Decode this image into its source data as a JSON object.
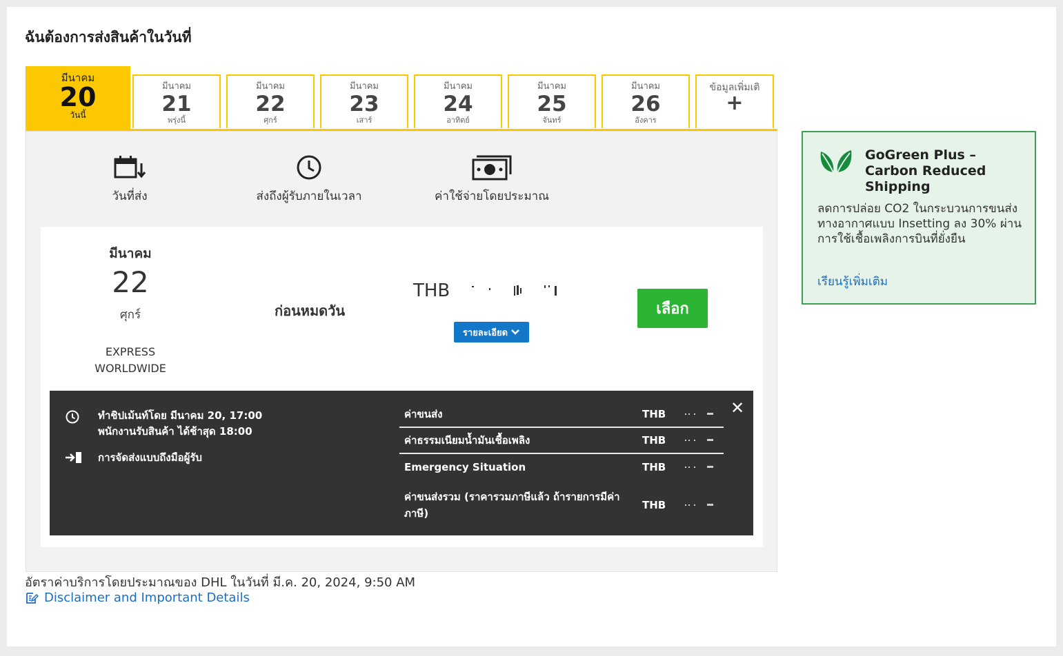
{
  "heading": "ฉันต้องการส่งสินค้าในวันที่",
  "tabs": [
    {
      "month": "มีนาคม",
      "day": "20",
      "weekday": "วันนี้",
      "active": true
    },
    {
      "month": "มีนาคม",
      "day": "21",
      "weekday": "พรุ่งนี้"
    },
    {
      "month": "มีนาคม",
      "day": "22",
      "weekday": "ศุกร์"
    },
    {
      "month": "มีนาคม",
      "day": "23",
      "weekday": "เสาร์"
    },
    {
      "month": "มีนาคม",
      "day": "24",
      "weekday": "อาทิตย์"
    },
    {
      "month": "มีนาคม",
      "day": "25",
      "weekday": "จันทร์"
    },
    {
      "month": "มีนาคม",
      "day": "26",
      "weekday": "อังคาร"
    }
  ],
  "more_tab": {
    "label": "ข้อมูลเพิ่มเติ",
    "icon": "+"
  },
  "columns": {
    "ship_date": "วันที่ส่ง",
    "delivered_by": "ส่งถึงผู้รับภายในเวลา",
    "estimated_cost": "ค่าใช้จ่ายโดยประมาณ"
  },
  "option": {
    "month": "มีนาคม",
    "day": "22",
    "weekday": "ศุกร์",
    "product": "EXPRESS WORLDWIDE",
    "delivery_time": "ก่อนหมดวัน",
    "currency": "THB",
    "details_label": "รายละเอียด",
    "select_label": "เลือก"
  },
  "details": {
    "pickup_line1": "ทำชิปเม้นท์โดย มีนาคม 20, 17:00",
    "pickup_line2": "พนักงานรับสินค้า ได้ช้าสุด 18:00",
    "delivery_type": "การจัดส่งแบบถึงมือผู้รับ",
    "charges": [
      {
        "label": "ค่าขนส่ง",
        "currency": "THB"
      },
      {
        "label": "ค่าธรรมเนียมน้ำมันเชื้อเพลิง",
        "currency": "THB"
      },
      {
        "label": "Emergency Situation",
        "currency": "THB"
      },
      {
        "label": "ค่าขนส่งรวม (ราคารวมภาษีแล้ว ถ้ารายการมีค่าภาษี)",
        "currency": "THB"
      }
    ]
  },
  "footer": {
    "rate_note": "อัตราค่าบริการโดยประมาณของ DHL ในวันที่ มี.ค. 20, 2024, 9:50 AM",
    "disclaimer_link": "Disclaimer and Important Details"
  },
  "gogreen": {
    "title_line1": "GoGreen Plus –",
    "title_line2": "Carbon Reduced",
    "title_line3": "Shipping",
    "text": "ลดการปล่อย CO2 ในกระบวนการขนส่งทางอากาศแบบ Insetting ลง 30% ผ่านการใช้เชื้อเพลิงการบินที่ยั่งยืน",
    "link": "เรียนรู้เพิ่มเติม"
  },
  "colors": {
    "accent": "#fcc900",
    "select": "#2bb533",
    "details": "#1276c9",
    "dark": "#333333",
    "link": "#1a6fc4",
    "green_bg": "#e6f3e8"
  }
}
